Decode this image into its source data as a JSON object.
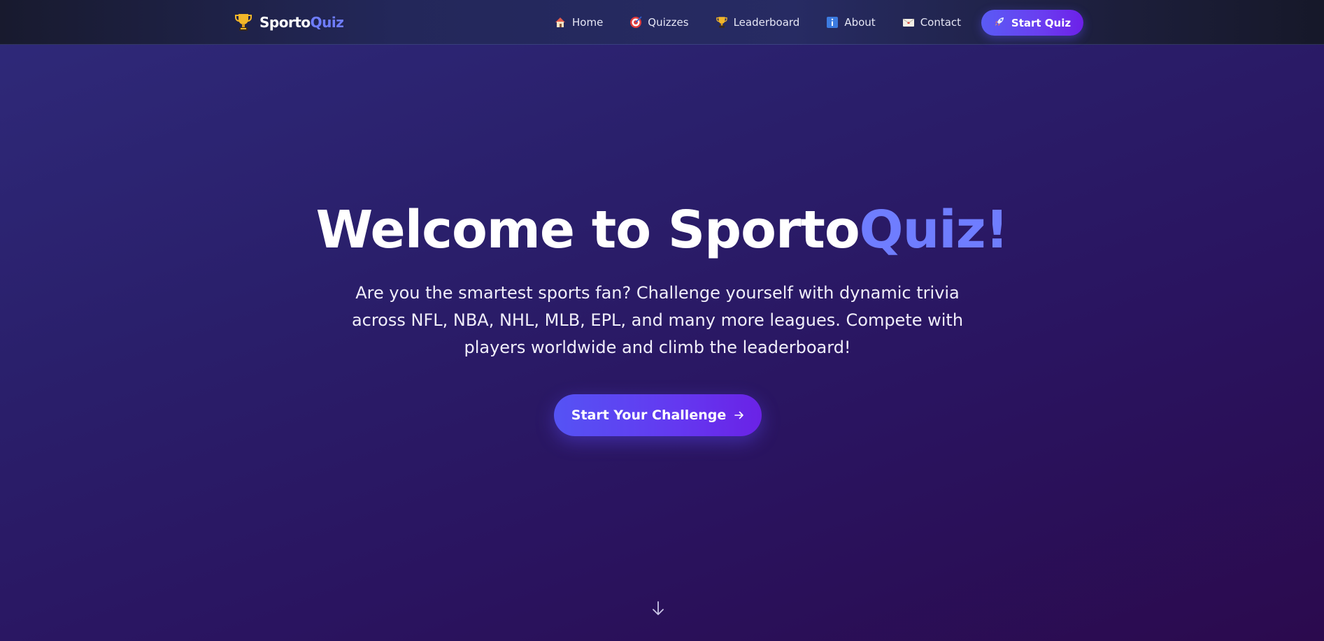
{
  "brand": {
    "name_main": "Sporto",
    "name_accent": "Quiz",
    "icon": "trophy-icon"
  },
  "nav": {
    "items": [
      {
        "label": "Home",
        "icon": "house-icon"
      },
      {
        "label": "Quizzes",
        "icon": "target-icon"
      },
      {
        "label": "Leaderboard",
        "icon": "trophy-icon"
      },
      {
        "label": "About",
        "icon": "info-icon"
      },
      {
        "label": "Contact",
        "icon": "envelope-icon"
      }
    ],
    "cta_label": "Start Quiz",
    "cta_icon": "rocket-icon"
  },
  "hero": {
    "title_main": "Welcome to Sporto",
    "title_accent": "Quiz!",
    "subtitle": "Are you the smartest sports fan? Challenge yourself with dynamic trivia across NFL, NBA, NHL, MLB, EPL, and many more leagues. Compete with players worldwide and climb the leaderboard!",
    "button_label": "Start Your Challenge",
    "button_icon": "arrow-right-icon",
    "scroll_icon": "arrow-down-icon"
  },
  "colors": {
    "accent": "#6f7dff",
    "button_start": "#5553f4",
    "button_end": "#6a22e6",
    "background_top": "#2f2a7a",
    "background_bottom": "#2b0a4e"
  }
}
